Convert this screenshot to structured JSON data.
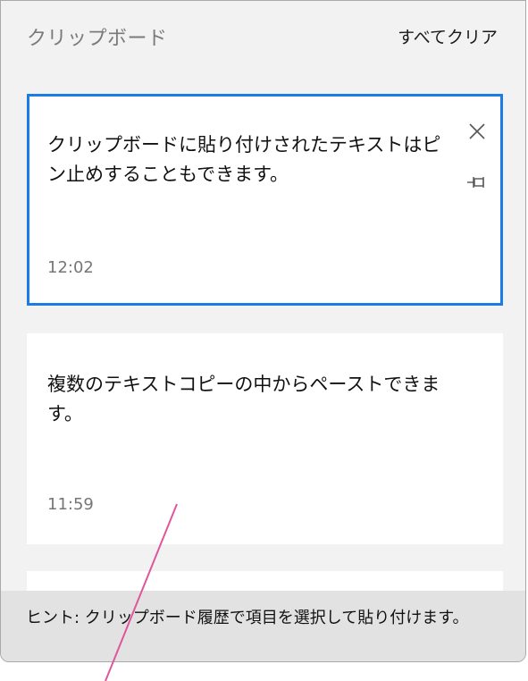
{
  "header": {
    "title": "クリップボード",
    "clear_all_label": "すべてクリア"
  },
  "items": [
    {
      "text": "クリップボードに貼り付けされたテキストはピン止めすることもできます。",
      "time": "12:02",
      "selected": true,
      "actions": [
        "close-icon",
        "pin-icon"
      ]
    },
    {
      "text": "複数のテキストコピーの中からペーストできます。",
      "time": "11:59",
      "selected": false
    },
    {
      "text": "",
      "time": "",
      "selected": false
    }
  ],
  "hint": {
    "text": "ヒント: クリップボード履歴で項目を選択して貼り付けます。"
  },
  "colors": {
    "accent_border": "#1a7ce4",
    "panel_bg": "#f2f2f2",
    "hint_bg": "#e2e2e2",
    "annotation_line": "#e0559c"
  }
}
